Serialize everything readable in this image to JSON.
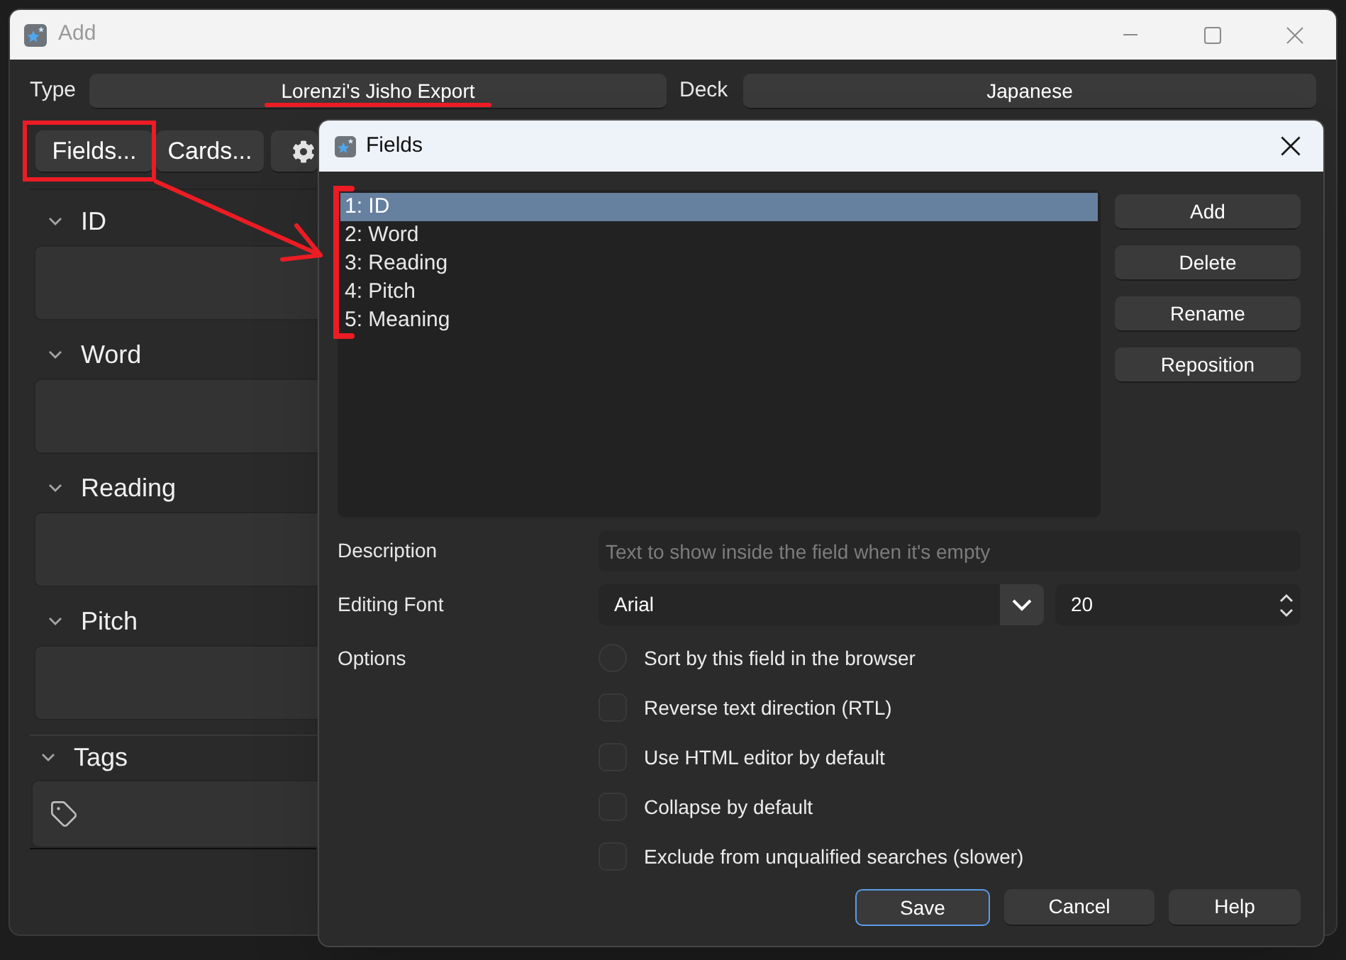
{
  "window": {
    "title": "Add"
  },
  "note_type": {
    "label": "Type",
    "value": "Lorenzi's Jisho Export"
  },
  "deck": {
    "label": "Deck",
    "value": "Japanese"
  },
  "toolbar": {
    "buttons": [
      "Fields...",
      "Cards..."
    ]
  },
  "editor_fields": [
    {
      "name": "ID",
      "expanded": true
    },
    {
      "name": "Word",
      "expanded": true
    },
    {
      "name": "Reading",
      "expanded": true
    },
    {
      "name": "Pitch",
      "expanded": true
    }
  ],
  "tags": {
    "label": "Tags",
    "expanded": true
  },
  "fields_dialog": {
    "title": "Fields",
    "fields": [
      {
        "label": "1: ID",
        "selected": true
      },
      {
        "label": "2: Word",
        "selected": false
      },
      {
        "label": "3: Reading",
        "selected": false
      },
      {
        "label": "4: Pitch",
        "selected": false
      },
      {
        "label": "5: Meaning",
        "selected": false
      }
    ],
    "buttons": [
      "Add",
      "Delete",
      "Rename",
      "Reposition"
    ],
    "description": {
      "label": "Description",
      "placeholder": "Text to show inside the field when it's empty"
    },
    "editing_font": {
      "label": "Editing Font",
      "font": "Arial",
      "size": "20"
    },
    "options": {
      "label": "Options",
      "items": [
        {
          "kind": "radio",
          "label": "Sort by this field in the browser",
          "checked": false
        },
        {
          "kind": "checkbox",
          "label": "Reverse text direction (RTL)",
          "checked": false
        },
        {
          "kind": "checkbox",
          "label": "Use HTML editor by default",
          "checked": false
        },
        {
          "kind": "checkbox",
          "label": "Collapse by default",
          "checked": false
        },
        {
          "kind": "checkbox",
          "label": "Exclude from unqualified searches (slower)",
          "checked": false
        }
      ]
    },
    "footer_buttons": [
      {
        "label": "Save",
        "focused": true
      },
      {
        "label": "Cancel",
        "focused": false
      },
      {
        "label": "Help",
        "focused": false
      }
    ]
  }
}
